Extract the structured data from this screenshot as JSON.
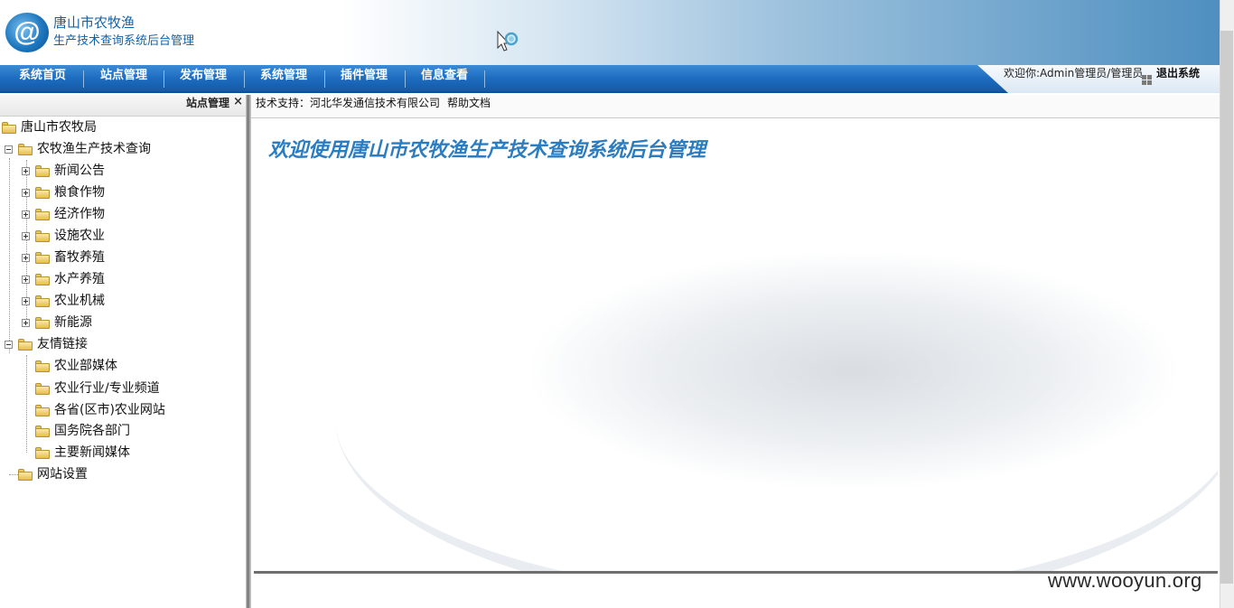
{
  "header": {
    "logo_icon": "at-sign-logo",
    "title": "唐山市农牧渔",
    "subtitle": "生产技术查询系统后台管理",
    "cursor_icon": "busy-cursor-icon"
  },
  "nav": {
    "items": [
      "系统首页",
      "站点管理",
      "发布管理",
      "系统管理",
      "插件管理",
      "信息查看"
    ],
    "welcome": "欢迎你:Admin管理员/管理员",
    "logout_icon": "grid-icon",
    "logout": "退出系统"
  },
  "left_panel": {
    "title": "站点管理",
    "close": "×",
    "tree": {
      "root": "唐山市农牧局",
      "group1": {
        "label": "农牧渔生产技术查询",
        "children": [
          "新闻公告",
          "粮食作物",
          "经济作物",
          "设施农业",
          "畜牧养殖",
          "水产养殖",
          "农业机械",
          "新能源"
        ]
      },
      "group2": {
        "label": "友情链接",
        "children": [
          "农业部媒体",
          "农业行业/专业频道",
          "各省(区市)农业网站",
          "国务院各部门",
          "主要新闻媒体"
        ]
      },
      "settings": "网站设置"
    }
  },
  "right_panel": {
    "support": "技术支持：河北华发通信技术有限公司",
    "help": "帮助文档",
    "welcome_title": "欢迎使用唐山市农牧渔生产技术查询系统后台管理"
  },
  "watermark": "www.wooyun.org",
  "colors": {
    "nav_blue": "#1e6cc0",
    "title_blue": "#2c7cc0",
    "brand_blue": "#1361a5"
  }
}
